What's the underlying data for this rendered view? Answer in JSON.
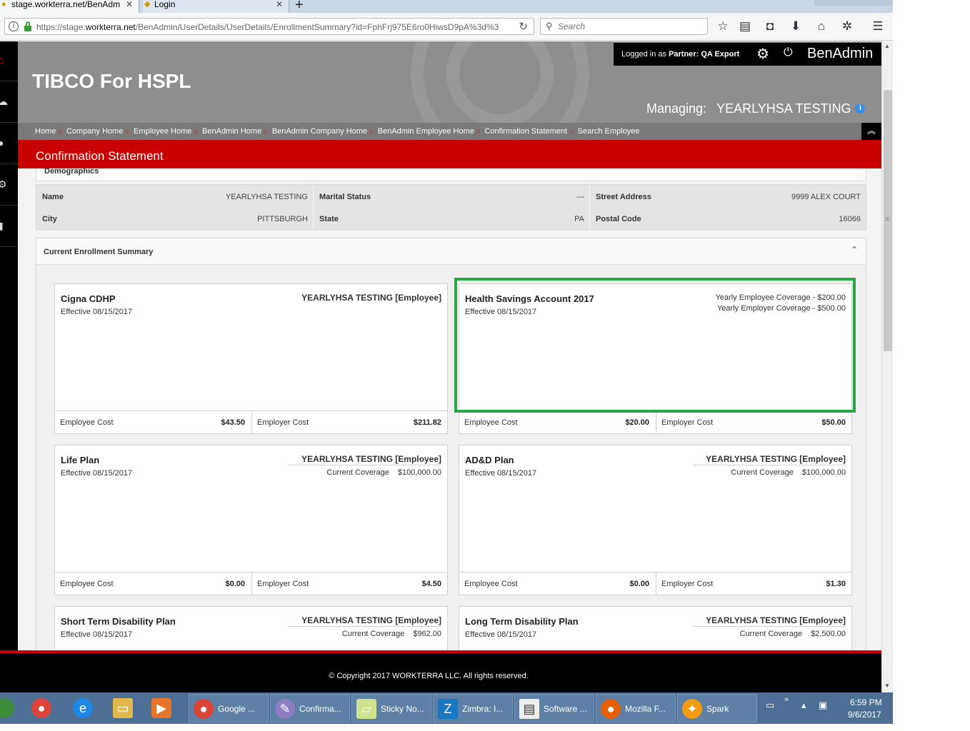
{
  "browser": {
    "tabs": [
      {
        "label": "stage.workterra.net/BenAdm"
      },
      {
        "label": "Login"
      }
    ],
    "url_prefix": "https://stage.",
    "url_domain": "workterra.net",
    "url_rest": "/BenAdmin/UserDetails/UserDetails/EnrollmentSummary?id=FphFrj975E6ro0HiwsD9pA%3d%3",
    "search_placeholder": "Search"
  },
  "header": {
    "company": "TIBCO For HSPL",
    "logged_prefix": "Logged in as",
    "partner_label": "Partner:",
    "partner_value": "QA Export",
    "brand": "BenAdmin",
    "managing_label": "Managing:",
    "managing_value": "YEARLYHSA TESTING"
  },
  "breadcrumb": [
    "Home",
    "Company Home",
    "Employee Home",
    "BenAdmin Home",
    "BenAdmin Company Home",
    "BenAdmin Employee Home",
    "Confirmation Statement",
    "Search Employee"
  ],
  "page_title": "Confirmation Statement",
  "demographics": {
    "title": "Demographics",
    "fields": [
      {
        "label": "Name",
        "value": "YEARLYHSA TESTING"
      },
      {
        "label": "Marital Status",
        "value": "---"
      },
      {
        "label": "Street Address",
        "value": "9999 ALEX COURT"
      },
      {
        "label": "City",
        "value": "PITTSBURGH"
      },
      {
        "label": "State",
        "value": "PA"
      },
      {
        "label": "Postal Code",
        "value": "16066"
      }
    ]
  },
  "enrollment": {
    "title": "Current Enrollment Summary",
    "cost_labels": {
      "employee": "Employee Cost",
      "employer": "Employer Cost"
    },
    "plans": [
      {
        "name": "Cigna CDHP",
        "effective": "Effective 08/15/2017",
        "who": "YEARLYHSA TESTING [Employee]",
        "employee_cost": "$43.50",
        "employer_cost": "$211.82"
      },
      {
        "name": "Health Savings Account 2017",
        "effective": "Effective 08/15/2017",
        "yearly_employee": "Yearly Employee Coverage - $200.00",
        "yearly_employer": "Yearly Employer Coverage - $500.00",
        "employee_cost": "$20.00",
        "employer_cost": "$50.00"
      },
      {
        "name": "Life Plan",
        "effective": "Effective 08/15/2017",
        "who": "YEARLYHSA TESTING [Employee]",
        "coverage_label": "Current Coverage",
        "coverage": "$100,000.00",
        "employee_cost": "$0.00",
        "employer_cost": "$4.50"
      },
      {
        "name": "AD&D Plan",
        "effective": "Effective 08/15/2017",
        "who": "YEARLYHSA TESTING [Employee]",
        "coverage_label": "Current Coverage",
        "coverage": "$100,000.00",
        "employee_cost": "$0.00",
        "employer_cost": "$1.30"
      },
      {
        "name": "Short Term Disability Plan",
        "effective": "Effective 08/15/2017",
        "who": "YEARLYHSA TESTING [Employee]",
        "coverage_label": "Current Coverage",
        "coverage": "$962.00"
      },
      {
        "name": "Long Term Disability Plan",
        "effective": "Effective 08/15/2017",
        "who": "YEARLYHSA TESTING [Employee]",
        "coverage_label": "Current Coverage",
        "coverage": "$2,500.00"
      }
    ]
  },
  "footer": {
    "copyright": "© Copyright 2017 WORKTERRA LLC. All rights reserved."
  },
  "taskbar": {
    "items": [
      {
        "label": "Google ..."
      },
      {
        "label": "Confirma..."
      },
      {
        "label": "Sticky No..."
      },
      {
        "label": "Zimbra: I..."
      },
      {
        "label": "Software ..."
      },
      {
        "label": "Mozilla F..."
      },
      {
        "label": "Spark"
      }
    ],
    "time": "6:59 PM",
    "date": "9/6/2017"
  },
  "colors": {
    "brand_red": "#c90000",
    "highlight_green": "#27a745",
    "header_gray": "#8e8e8e"
  }
}
